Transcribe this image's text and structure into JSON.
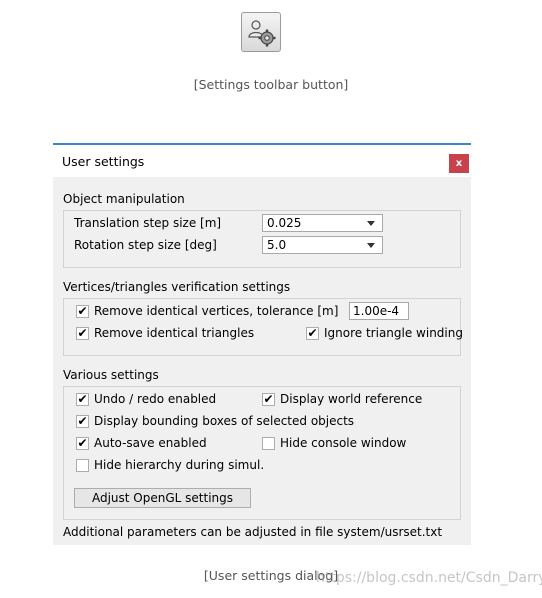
{
  "toolbar": {
    "icon": "user-settings-icon",
    "caption": "[Settings toolbar button]"
  },
  "dialog": {
    "title": "User settings",
    "close_label": "x",
    "object_manipulation": {
      "title": "Object manipulation",
      "translation_label": "Translation step size [m]",
      "translation_value": "0.025",
      "rotation_label": "Rotation step size [deg]",
      "rotation_value": "5.0"
    },
    "verification": {
      "title": "Vertices/triangles verification settings",
      "remove_vertices_label": "Remove identical vertices, tolerance [m]",
      "remove_vertices_checked": true,
      "tolerance_value": "1.00e-4",
      "remove_triangles_label": "Remove identical triangles",
      "remove_triangles_checked": true,
      "ignore_winding_label": "Ignore triangle winding",
      "ignore_winding_checked": true
    },
    "various": {
      "title": "Various settings",
      "undo_redo_label": "Undo / redo enabled",
      "undo_redo_checked": true,
      "world_ref_label": "Display world reference",
      "world_ref_checked": true,
      "bounding_boxes_label": "Display bounding boxes of selected objects",
      "bounding_boxes_checked": true,
      "autosave_label": "Auto-save enabled",
      "autosave_checked": true,
      "hide_console_label": "Hide console window",
      "hide_console_checked": false,
      "hide_hierarchy_label": "Hide hierarchy during simul.",
      "hide_hierarchy_checked": false,
      "opengl_button": "Adjust OpenGL settings"
    },
    "footer": "Additional parameters can be adjusted in file system/usrset.txt"
  },
  "dialog_caption": "[User settings dialog]",
  "watermark": "https://blog.csdn.net/Csdn_Darry",
  "colors": {
    "title_accent": "#3d86c6",
    "close_bg": "#c7424a"
  }
}
